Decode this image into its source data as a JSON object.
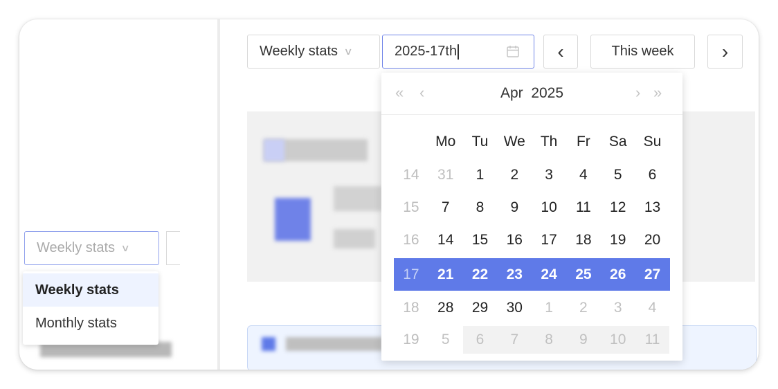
{
  "toolbar": {
    "period_select": "Weekly stats",
    "date_value": "2025-17th",
    "prev_label": "‹",
    "this_week_label": "This week",
    "next_label": "›"
  },
  "calendar": {
    "month": "Apr",
    "year": "2025",
    "nav_prev_year": "«",
    "nav_prev_month": "‹",
    "nav_next_month": "›",
    "nav_next_year": "»",
    "weekdays": [
      "Mo",
      "Tu",
      "We",
      "Th",
      "Fr",
      "Sa",
      "Su"
    ],
    "weeks": [
      {
        "week": "14",
        "days": [
          "31",
          "1",
          "2",
          "3",
          "4",
          "5",
          "6"
        ]
      },
      {
        "week": "15",
        "days": [
          "7",
          "8",
          "9",
          "10",
          "11",
          "12",
          "13"
        ]
      },
      {
        "week": "16",
        "days": [
          "14",
          "15",
          "16",
          "17",
          "18",
          "19",
          "20"
        ]
      },
      {
        "week": "17",
        "days": [
          "21",
          "22",
          "23",
          "24",
          "25",
          "26",
          "27"
        ]
      },
      {
        "week": "18",
        "days": [
          "28",
          "29",
          "30",
          "1",
          "2",
          "3",
          "4"
        ]
      },
      {
        "week": "19",
        "days": [
          "5",
          "6",
          "7",
          "8",
          "9",
          "10",
          "11"
        ]
      }
    ],
    "selected_week": "17"
  },
  "left_panel": {
    "select_value": "Weekly stats",
    "dropdown_options": [
      "Weekly stats",
      "Monthly stats"
    ]
  },
  "colors": {
    "accent": "#5f7ae8",
    "border_focus": "#6f84e8"
  }
}
